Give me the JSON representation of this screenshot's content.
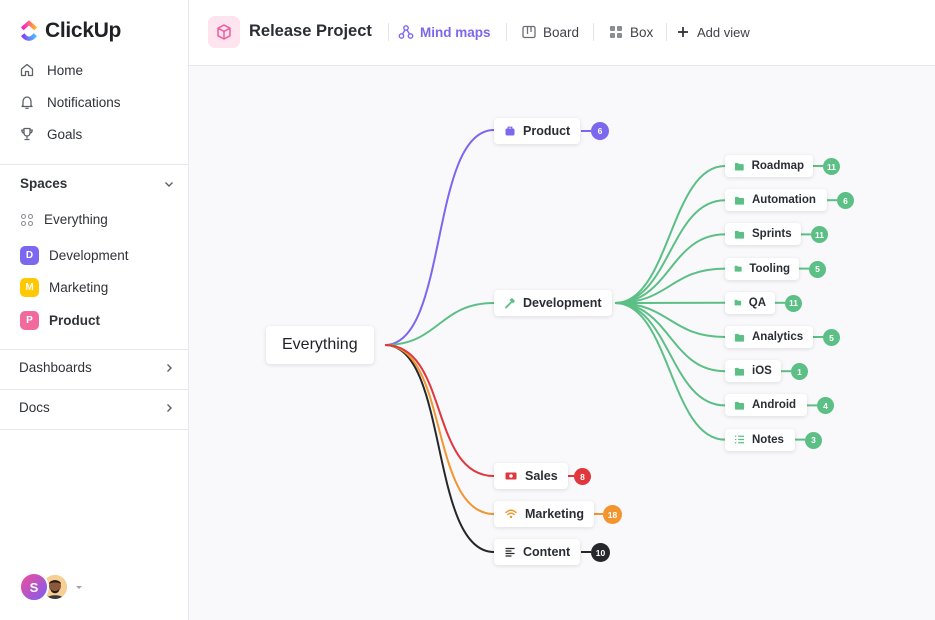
{
  "app": {
    "name": "ClickUp"
  },
  "sidebar": {
    "nav": [
      {
        "label": "Home",
        "icon": "home-icon"
      },
      {
        "label": "Notifications",
        "icon": "bell-icon"
      },
      {
        "label": "Goals",
        "icon": "trophy-icon"
      }
    ],
    "spaces_label": "Spaces",
    "everything_label": "Everything",
    "spaces": [
      {
        "letter": "D",
        "label": "Development",
        "color": "#7b68ee"
      },
      {
        "letter": "M",
        "label": "Marketing",
        "color": "#ffc800"
      },
      {
        "letter": "P",
        "label": "Product",
        "color": "#f06a9e"
      }
    ],
    "dashboards_label": "Dashboards",
    "docs_label": "Docs",
    "user_initial": "S"
  },
  "header": {
    "project_title": "Release Project",
    "tabs": [
      {
        "label": "Mind maps",
        "icon": "mindmap-icon",
        "active": true
      },
      {
        "label": "Board",
        "icon": "board-icon",
        "active": false
      },
      {
        "label": "Box",
        "icon": "box-icon",
        "active": false
      }
    ],
    "add_view_label": "Add view"
  },
  "mindmap": {
    "root": "Everything",
    "branches": [
      {
        "label": "Product",
        "count": "6",
        "color": "#7b68ee",
        "icon": "briefcase-icon"
      },
      {
        "label": "Development",
        "count": "",
        "color": "#5cbf85",
        "icon": "hammer-icon"
      },
      {
        "label": "Sales",
        "count": "8",
        "color": "#e0373c",
        "icon": "money-icon"
      },
      {
        "label": "Marketing",
        "count": "18",
        "color": "#f2952f",
        "icon": "wifi-icon"
      },
      {
        "label": "Content",
        "count": "10",
        "color": "#25272b",
        "icon": "text-lines-icon"
      }
    ],
    "dev_children": [
      {
        "label": "Roadmap",
        "count": "11",
        "icon": "folder-icon"
      },
      {
        "label": "Automation",
        "count": "6",
        "icon": "folder-icon"
      },
      {
        "label": "Sprints",
        "count": "11",
        "icon": "folder-icon"
      },
      {
        "label": "Tooling",
        "count": "5",
        "icon": "folder-icon"
      },
      {
        "label": "QA",
        "count": "11",
        "icon": "folder-icon"
      },
      {
        "label": "Analytics",
        "count": "5",
        "icon": "folder-icon"
      },
      {
        "label": "iOS",
        "count": "1",
        "icon": "folder-icon"
      },
      {
        "label": "Android",
        "count": "4",
        "icon": "folder-icon"
      },
      {
        "label": "Notes",
        "count": "3",
        "icon": "list-icon"
      }
    ],
    "dev_color": "#5cbf85"
  }
}
